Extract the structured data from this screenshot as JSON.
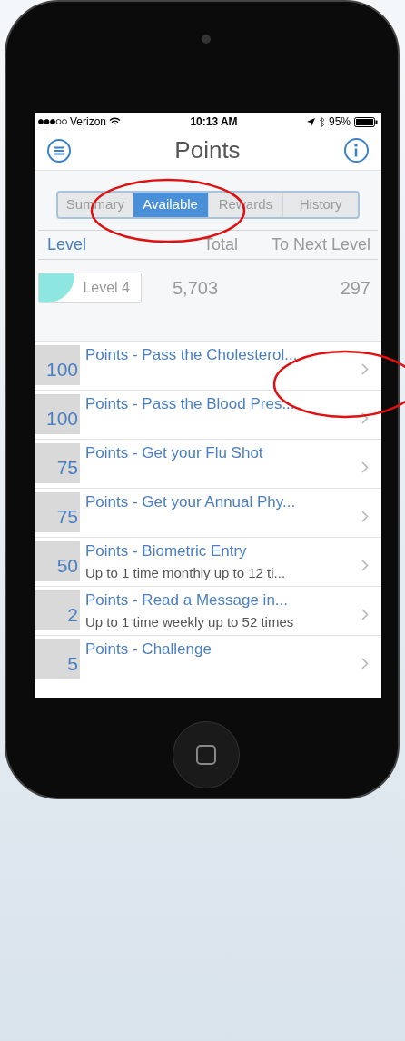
{
  "status_bar": {
    "carrier": "Verizon",
    "time": "10:13 AM",
    "battery": "95%"
  },
  "title": "Points",
  "tabs": [
    {
      "label": "Summary",
      "selected": false
    },
    {
      "label": "Available",
      "selected": true
    },
    {
      "label": "Rewards",
      "selected": false
    },
    {
      "label": "History",
      "selected": false
    }
  ],
  "summary": {
    "columns": [
      "Level",
      "Total",
      "To Next Level"
    ],
    "level_badge": {
      "label": "Level 4",
      "level": 0.35
    },
    "total": "5,703",
    "to_next_level": "297"
  },
  "items": [
    {
      "points": "100",
      "title": "Points - Pass the Cholesterol..."
    },
    {
      "points": "100",
      "title": "Points - Pass the Blood Pres..."
    },
    {
      "points": "75",
      "title": "Points - Get your Flu Shot"
    },
    {
      "points": "75",
      "title": "Points - Get your Annual Phy..."
    },
    {
      "points": "50",
      "title": "Points - Biometric Entry",
      "subtitle": "Up to 1 time monthly up to 12 ti..."
    },
    {
      "points": "2",
      "title": "Points - Read a Message in...",
      "subtitle": "Up to 1 time weekly up to 52 times"
    },
    {
      "points": "5",
      "title": "Points - Challenge"
    }
  ]
}
